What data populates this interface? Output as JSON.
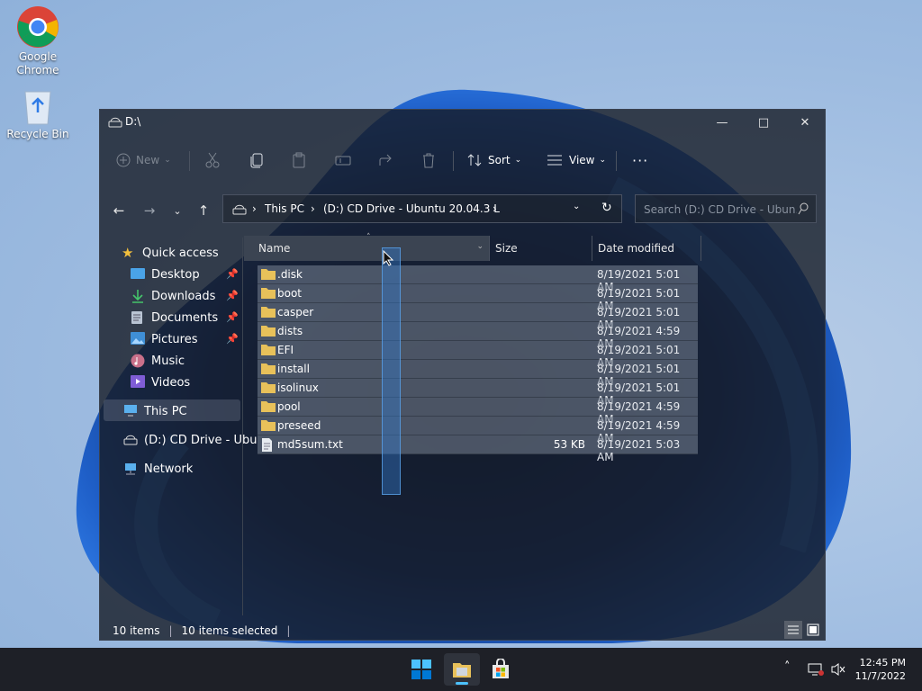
{
  "desktop": {
    "icons": [
      {
        "label_line1": "Google",
        "label_line2": "Chrome"
      },
      {
        "label_line1": "Recycle Bin",
        "label_line2": ""
      }
    ]
  },
  "window": {
    "title": "D:\\",
    "toolbar": {
      "new_label": "New",
      "sort_label": "Sort",
      "view_label": "View"
    },
    "address": {
      "this_pc": "This PC",
      "drive": "(D:) CD Drive - Ubuntu 20.04.3 L"
    },
    "search_placeholder": "Search (D:) CD Drive - Ubun...",
    "sidebar": {
      "quick_access": "Quick access",
      "items": [
        "Desktop",
        "Downloads",
        "Documents",
        "Pictures",
        "Music",
        "Videos"
      ],
      "this_pc": "This PC",
      "cd_drive": "(D:) CD Drive - Ubu",
      "network": "Network"
    },
    "columns": {
      "name": "Name",
      "size": "Size",
      "date": "Date modified"
    },
    "files": [
      {
        "name": ".disk",
        "size": "",
        "date": "8/19/2021 5:01 AM",
        "type": "folder"
      },
      {
        "name": "boot",
        "size": "",
        "date": "8/19/2021 5:01 AM",
        "type": "folder"
      },
      {
        "name": "casper",
        "size": "",
        "date": "8/19/2021 5:01 AM",
        "type": "folder"
      },
      {
        "name": "dists",
        "size": "",
        "date": "8/19/2021 4:59 AM",
        "type": "folder"
      },
      {
        "name": "EFI",
        "size": "",
        "date": "8/19/2021 5:01 AM",
        "type": "folder"
      },
      {
        "name": "install",
        "size": "",
        "date": "8/19/2021 5:01 AM",
        "type": "folder"
      },
      {
        "name": "isolinux",
        "size": "",
        "date": "8/19/2021 5:01 AM",
        "type": "folder"
      },
      {
        "name": "pool",
        "size": "",
        "date": "8/19/2021 4:59 AM",
        "type": "folder"
      },
      {
        "name": "preseed",
        "size": "",
        "date": "8/19/2021 4:59 AM",
        "type": "folder"
      },
      {
        "name": "md5sum.txt",
        "size": "53 KB",
        "date": "8/19/2021 5:03 AM",
        "type": "file"
      }
    ],
    "status": {
      "count": "10 items",
      "selected": "10 items selected"
    }
  },
  "taskbar": {
    "time": "12:45 PM",
    "date": "11/7/2022"
  },
  "colors": {
    "accent": "#0078d4",
    "folder": "#e8c15a",
    "taskbar": "#1e2027"
  }
}
